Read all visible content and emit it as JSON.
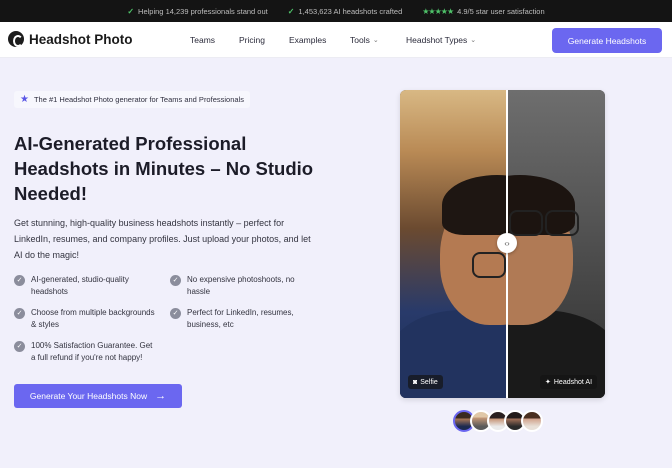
{
  "topbar": {
    "item1": "Helping 14,239 professionals stand out",
    "item2": "1,453,623 AI headshots crafted",
    "item3": "4.9/5 star user satisfaction",
    "rating_stars": 5
  },
  "nav": {
    "logo": "Headshot Photo",
    "links": [
      "Teams",
      "Pricing",
      "Examples",
      "Tools",
      "Headshot Types"
    ],
    "cta": "Generate Headshots"
  },
  "hero": {
    "badge": "The #1 Headshot Photo generator for Teams and Professionals",
    "headline": "AI-Generated Professional Headshots in Minutes – No Studio Needed!",
    "subtext": "Get stunning, high-quality business headshots instantly – perfect for LinkedIn, resumes, and company profiles. Just upload your photos, and let AI do the magic!",
    "features": [
      "AI-generated, studio-quality headshots",
      "No expensive photoshoots, no hassle",
      "Choose from multiple backgrounds & styles",
      "Perfect for LinkedIn, resumes, business, etc",
      "100% Satisfaction Guarantee. Get a full refund if you're not happy!"
    ],
    "cta": "Generate Your Headshots Now"
  },
  "comparison": {
    "left_label": "Selfie",
    "right_label": "Headshot AI"
  },
  "colors": {
    "accent": "#6b67f0",
    "background": "#f1f0fb",
    "topbar": "#141414",
    "check": "#4fc36a"
  }
}
